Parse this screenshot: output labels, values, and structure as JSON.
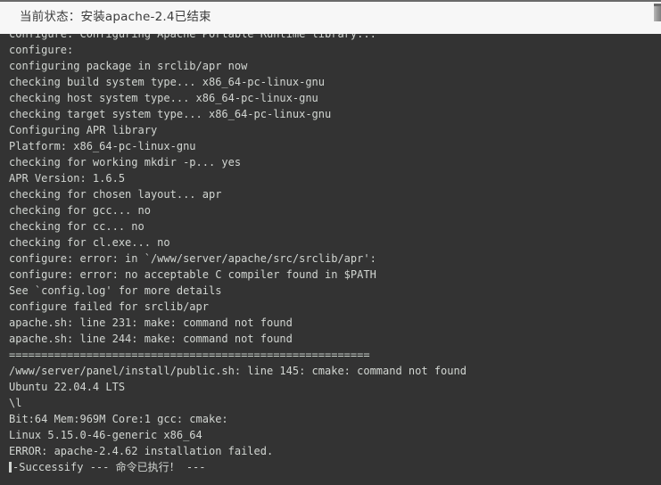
{
  "header": {
    "status_text": "当前状态：安装apache-2.4已结束",
    "scrollbar_icon": "scrollbar-thumb"
  },
  "terminal": {
    "background_color": "#333333",
    "text_color": "#d2d6d2",
    "cursor_glyph": "block-cursor",
    "lines": [
      "configure: Configuring Apache Portable Runtime library...",
      "configure:",
      "configuring package in srclib/apr now",
      "checking build system type... x86_64-pc-linux-gnu",
      "checking host system type... x86_64-pc-linux-gnu",
      "checking target system type... x86_64-pc-linux-gnu",
      "Configuring APR library",
      "Platform: x86_64-pc-linux-gnu",
      "checking for working mkdir -p... yes",
      "APR Version: 1.6.5",
      "checking for chosen layout... apr",
      "checking for gcc... no",
      "checking for cc... no",
      "checking for cl.exe... no",
      "configure: error: in `/www/server/apache/src/srclib/apr':",
      "configure: error: no acceptable C compiler found in $PATH",
      "See `config.log' for more details",
      "configure failed for srclib/apr",
      "apache.sh: line 231: make: command not found",
      "apache.sh: line 244: make: command not found",
      "========================================================",
      "/www/server/panel/install/public.sh: line 145: cmake: command not found",
      "Ubuntu 22.04.4 LTS",
      "\\l",
      "Bit:64 Mem:969M Core:1 gcc: cmake:",
      "Linux 5.15.0-46-generic x86_64",
      "ERROR: apache-2.4.62 installation failed."
    ],
    "final_line": "-Successify --- 命令已执行！ ---"
  }
}
